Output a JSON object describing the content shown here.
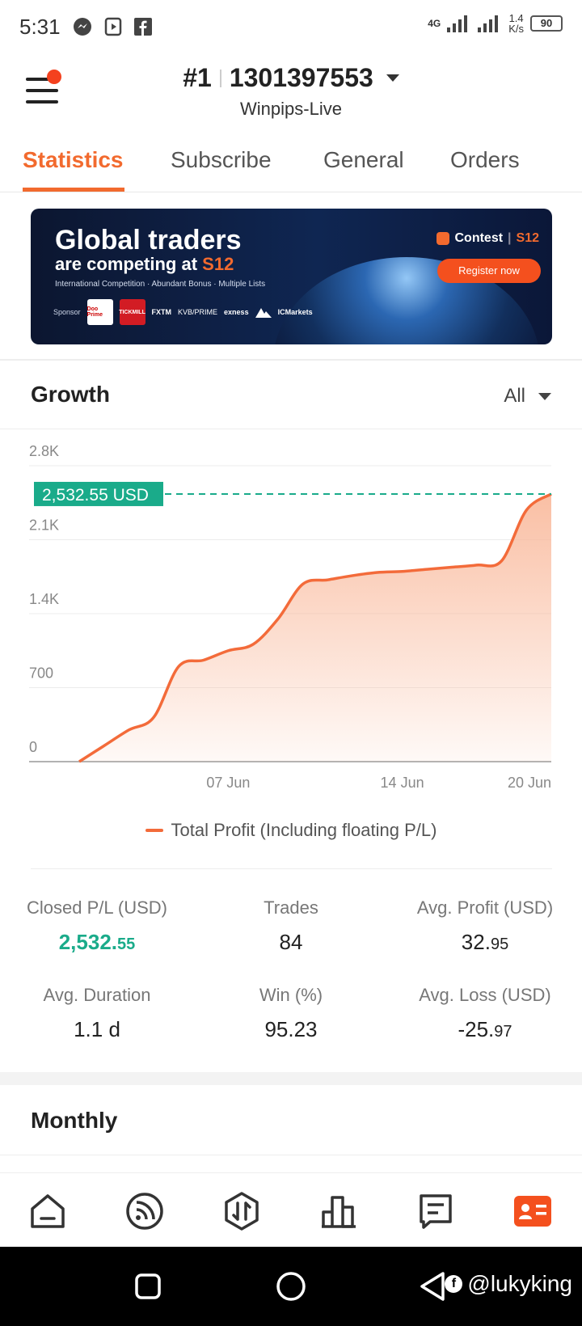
{
  "status_bar": {
    "time": "5:31",
    "network_type": "4G",
    "net_speed_value": "1.4",
    "net_speed_unit": "K/s",
    "battery": "90"
  },
  "header": {
    "rank": "#1",
    "account_number": "1301397553",
    "server": "Winpips-Live"
  },
  "tabs": [
    {
      "label": "Statistics",
      "active": true
    },
    {
      "label": "Subscribe",
      "active": false
    },
    {
      "label": "General",
      "active": false
    },
    {
      "label": "Orders",
      "active": false
    }
  ],
  "banner": {
    "line1": "Global traders",
    "line2_prefix": "are competing at ",
    "line2_highlight": "S12",
    "line3": "International Competition · Abundant Bonus · Multiple Lists",
    "sponsor_label": "Sponsor",
    "sponsors": [
      "Doo Prime",
      "TICKMILL",
      "FXTM",
      "KVB/PRIME",
      "exness",
      "",
      "ICMarkets"
    ],
    "contest_label": "Contest",
    "contest_highlight": "S12",
    "register_label": "Register now"
  },
  "growth": {
    "title": "Growth",
    "filter": "All",
    "current_value_label": "2,532.55 USD",
    "legend": "Total Profit (Including floating P/L)"
  },
  "chart_data": {
    "type": "area",
    "series": [
      {
        "name": "Total Profit (Including floating P/L)",
        "x": [
          "01 Jun",
          "02 Jun",
          "03 Jun",
          "04 Jun",
          "05 Jun",
          "06 Jun",
          "07 Jun",
          "08 Jun",
          "09 Jun",
          "10 Jun",
          "11 Jun",
          "12 Jun",
          "13 Jun",
          "14 Jun",
          "15 Jun",
          "16 Jun",
          "17 Jun",
          "18 Jun",
          "19 Jun",
          "20 Jun"
        ],
        "values": [
          0,
          150,
          300,
          420,
          900,
          960,
          1050,
          1110,
          1350,
          1680,
          1720,
          1760,
          1790,
          1800,
          1820,
          1840,
          1860,
          1900,
          2380,
          2532.55
        ]
      }
    ],
    "x_tick_labels": [
      "07 Jun",
      "14 Jun",
      "20 Jun"
    ],
    "y_tick_labels": [
      "0",
      "700",
      "1.4K",
      "2.1K",
      "2.8K"
    ],
    "y_ticks": [
      0,
      700,
      1400,
      2100,
      2800
    ],
    "ylim": [
      0,
      2800
    ],
    "reference_value": 2532.55,
    "grid": true,
    "colors": {
      "line": "#f36b3a",
      "fill_top": "#f9b89a",
      "reference": "#1aab8a"
    }
  },
  "stats": [
    {
      "label": "Closed P/L (USD)",
      "value_main": "2,532.",
      "value_decimals": "55",
      "highlight": true
    },
    {
      "label": "Trades",
      "value_main": "84",
      "value_decimals": "",
      "highlight": false
    },
    {
      "label": "Avg. Profit (USD)",
      "value_main": "32.",
      "value_decimals": "95",
      "highlight": false
    },
    {
      "label": "Avg. Duration",
      "value_main": "1.1 d",
      "value_decimals": "",
      "highlight": false
    },
    {
      "label": "Win (%)",
      "value_main": "95.23",
      "value_decimals": "",
      "highlight": false
    },
    {
      "label": "Avg. Loss (USD)",
      "value_main": "-25.",
      "value_decimals": "97",
      "highlight": false
    }
  ],
  "monthly": {
    "title": "Monthly"
  },
  "bottom_nav": [
    {
      "icon": "home-icon",
      "active": false
    },
    {
      "icon": "signal-feed-icon",
      "active": false
    },
    {
      "icon": "trade-icon",
      "active": false
    },
    {
      "icon": "chart-bars-icon",
      "active": false
    },
    {
      "icon": "message-icon",
      "active": false
    },
    {
      "icon": "profile-card-icon",
      "active": true
    }
  ],
  "watermark": {
    "text": "@lukyking"
  },
  "accent_color": "#f26a2e",
  "positive_color": "#1aab8a"
}
